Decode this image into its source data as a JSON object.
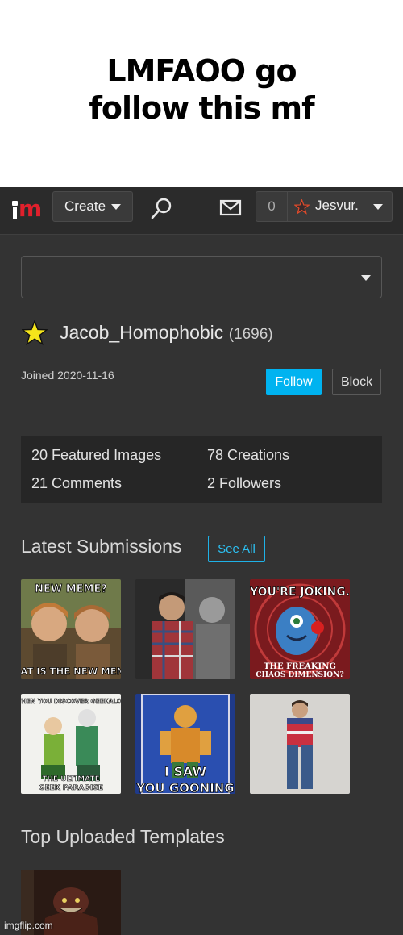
{
  "caption": {
    "line1": "LMFAOO go",
    "line2": "follow this mf"
  },
  "navbar": {
    "logo": "im",
    "create_label": "Create",
    "search_icon": "search-icon",
    "mail_icon": "mail-icon",
    "notification_count": "0",
    "username": "Jesvur."
  },
  "profile": {
    "name": "Jacob_Homophobic",
    "points": "(1696)",
    "joined": "Joined 2020-11-16",
    "follow_label": "Follow",
    "block_label": "Block"
  },
  "stats": {
    "featured": "20 Featured Images",
    "creations": "78 Creations",
    "comments": "21 Comments",
    "followers": "2 Followers"
  },
  "latest": {
    "title": "Latest Submissions",
    "see_all_label": "See All",
    "thumbs": [
      {
        "top": "NEW MEME?",
        "bottom": "HAT IS THE NEW MEMI"
      },
      {
        "top": "",
        "bottom": ""
      },
      {
        "top": "YOU'RE JOKING.",
        "bottom1": "THE FREAKING",
        "bottom2": "CHAOS DIMENSION?"
      },
      {
        "top": "WHEN YOU DISCOVER GEEKALOO",
        "bottom1": "THE ULTIMATE",
        "bottom2": "GEEK PARADISE"
      },
      {
        "top": "",
        "bottom1": "I SAW",
        "bottom2": "YOU GOONING"
      },
      {
        "top": "",
        "bottom": ""
      }
    ]
  },
  "templates": {
    "title": "Top Uploaded Templates"
  },
  "watermark": "imgflip.com",
  "colors": {
    "accent": "#00b3f0",
    "background": "#333333",
    "navbar": "#2b2b2b",
    "logo_red": "#e0202c",
    "star_yellow": "#f5e51b"
  }
}
